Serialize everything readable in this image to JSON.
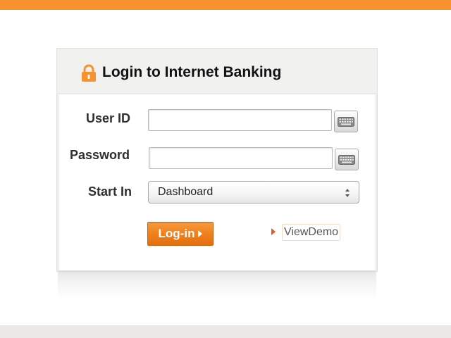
{
  "header_bar": {
    "color": "#f7922e"
  },
  "login": {
    "title": "Login to Internet Banking",
    "icon": "padlock-icon",
    "user_id_label": "User ID",
    "user_id_value": "",
    "password_label": "Password",
    "password_value": "",
    "keyboard_icon": "keyboard-icon",
    "start_in_label": "Start In",
    "start_in_selected": "Dashboard",
    "login_button_label": "Log-in",
    "view_demo_label": "ViewDemo"
  },
  "colors": {
    "accent": "#f7922e",
    "button": "#ef7e1b",
    "link_arrow": "#e45a2a"
  }
}
